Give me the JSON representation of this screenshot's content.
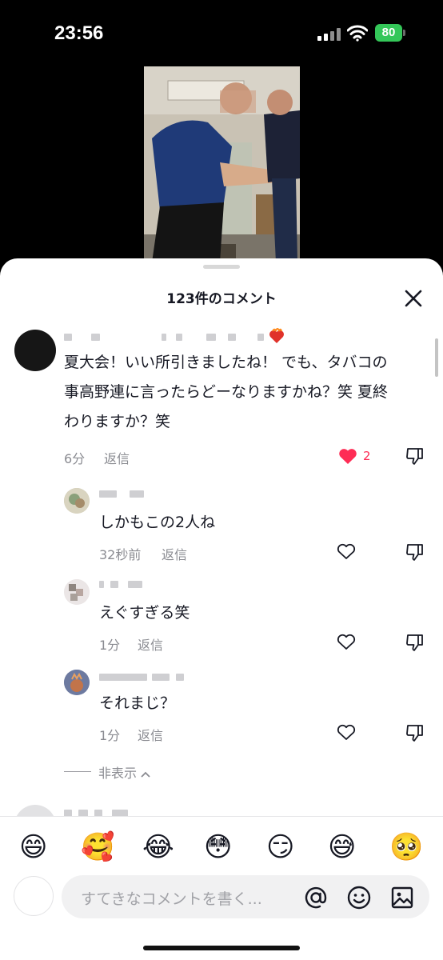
{
  "status_bar": {
    "time": "23:56",
    "battery": "80"
  },
  "sheet": {
    "title": "123件のコメント"
  },
  "comments": [
    {
      "text_lines": [
        "夏大会！いい所引きましたね！ でも、タバコの",
        "事高野連に言ったらどーなりますかね？笑 夏終",
        "わりますか？笑"
      ],
      "time": "6分",
      "reply": "返信",
      "likes": "2",
      "liked": true
    },
    {
      "text": "しかもこの2人ね",
      "time": "32秒前",
      "reply": "返信"
    },
    {
      "text": "えぐすぎる笑",
      "time": "1分",
      "reply": "返信"
    },
    {
      "text": "それまじ？",
      "time": "1分",
      "reply": "返信"
    }
  ],
  "hide_replies": "非表示",
  "emoji_bar": [
    "😄",
    "🥰",
    "😂",
    "😳",
    "😏",
    "😅",
    "🥺"
  ],
  "input": {
    "placeholder": "すてきなコメントを書く..."
  },
  "colors": {
    "accent": "#fe2c55",
    "battery": "#34c759",
    "text": "#161823",
    "meta": "#8a8b91"
  }
}
